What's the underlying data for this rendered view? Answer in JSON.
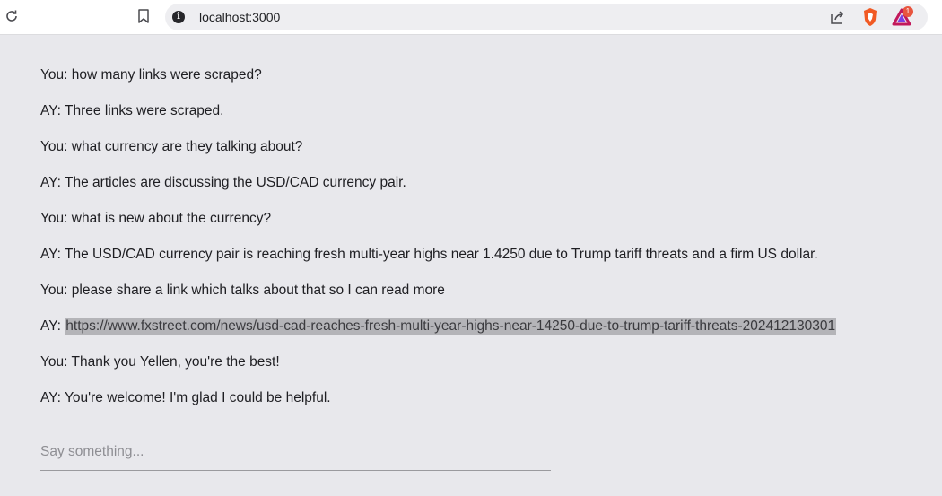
{
  "browser": {
    "url": "localhost:3000",
    "badge_count": "1"
  },
  "messages": [
    {
      "speaker": "You",
      "text": "how many links were scraped?"
    },
    {
      "speaker": "AY",
      "text": "Three links were scraped."
    },
    {
      "speaker": "You",
      "text": "what currency are they talking about?"
    },
    {
      "speaker": "AY",
      "text": "The articles are discussing the USD/CAD currency pair."
    },
    {
      "speaker": "You",
      "text": "what is new about the currency?"
    },
    {
      "speaker": "AY",
      "text": "The USD/CAD currency pair is reaching fresh multi-year highs near 1.4250 due to Trump tariff threats and a firm US dollar."
    },
    {
      "speaker": "You",
      "text": "please share a link which talks about that so I can read more"
    },
    {
      "speaker": "AY",
      "text": "https://www.fxstreet.com/news/usd-cad-reaches-fresh-multi-year-highs-near-14250-due-to-trump-tariff-threats-202412130301"
    },
    {
      "speaker": "You",
      "text": "Thank you Yellen, you're the best!"
    },
    {
      "speaker": "AY",
      "text": "You're welcome! I'm glad I could be helpful."
    }
  ],
  "input": {
    "placeholder": "Say something..."
  }
}
